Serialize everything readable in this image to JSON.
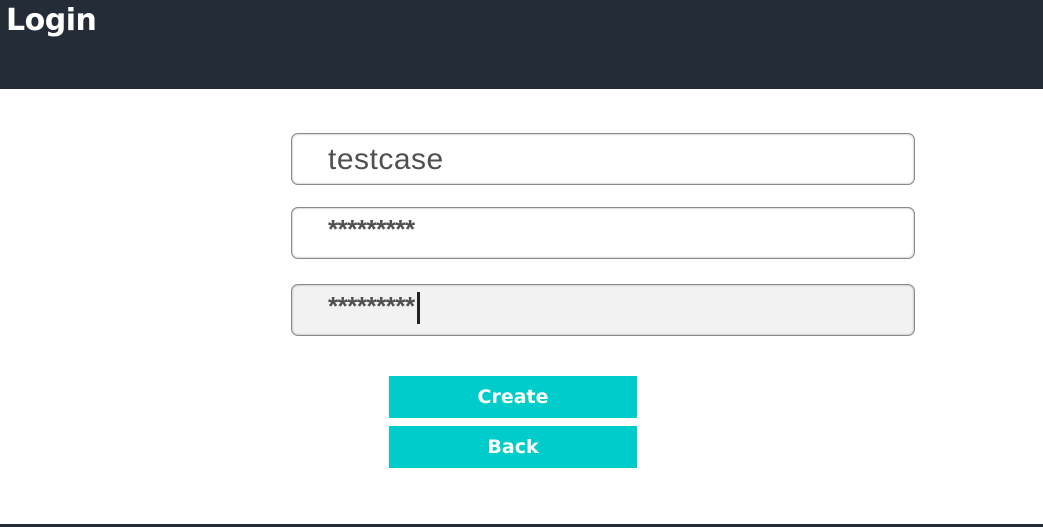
{
  "header": {
    "title": "Login"
  },
  "form": {
    "username_value": "testcase",
    "password_value": "*********",
    "confirm_password_value": "*********"
  },
  "buttons": {
    "create_label": "Create",
    "back_label": "Back"
  },
  "colors": {
    "header_bg": "#232c37",
    "button_bg": "#00cccb",
    "button_text": "#ffffff",
    "focused_field_bg": "#f2f2f2"
  }
}
